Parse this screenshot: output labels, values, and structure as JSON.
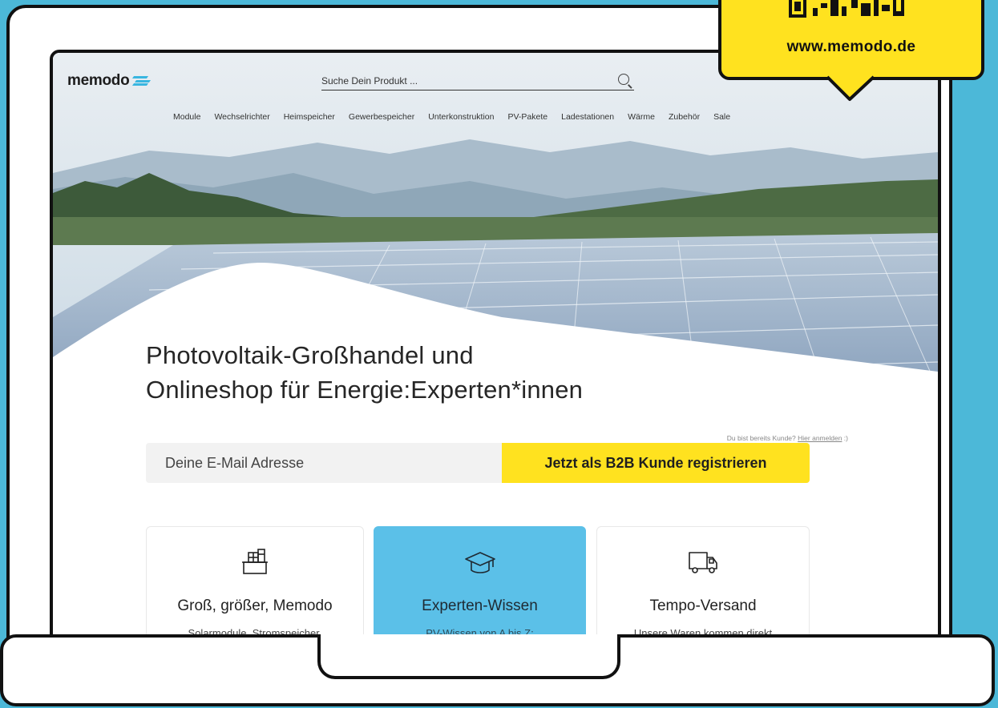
{
  "site": {
    "logo": "memodo",
    "search_placeholder": "Suche Dein Produkt ...",
    "nav": [
      "Module",
      "Wechselrichter",
      "Heimspeicher",
      "Gewerbespeicher",
      "Unterkonstruktion",
      "PV-Pakete",
      "Ladestationen",
      "Wärme",
      "Zubehör",
      "Sale"
    ],
    "headline_line1": "Photovoltaik-Großhandel und",
    "headline_line2": "Onlineshop für Energie:Experten*innen",
    "login_prompt": "Du bist bereits Kunde?",
    "login_link": "Hier anmelden",
    "login_suffix": ":)",
    "email_placeholder": "Deine E-Mail Adresse",
    "register_button": "Jetzt als B2B Kunde registrieren",
    "cards": [
      {
        "title": "Groß, größer, Memodo",
        "desc": "Solarmodule, Stromspeicher,",
        "icon": "warehouse-box-icon"
      },
      {
        "title": "Experten-Wissen",
        "desc": "PV-Wissen von A bis Z:",
        "icon": "graduation-cap-icon"
      },
      {
        "title": "Tempo-Versand",
        "desc": "Unsere Waren kommen direkt",
        "icon": "delivery-truck-icon"
      }
    ]
  },
  "tag": {
    "url": "www.memodo.de",
    "icon": "qr-code-icon"
  },
  "colors": {
    "background": "#4cb8d8",
    "accent_yellow": "#ffe21f",
    "card_blue": "#5bc0e8",
    "logo_blue": "#38b6e0"
  }
}
